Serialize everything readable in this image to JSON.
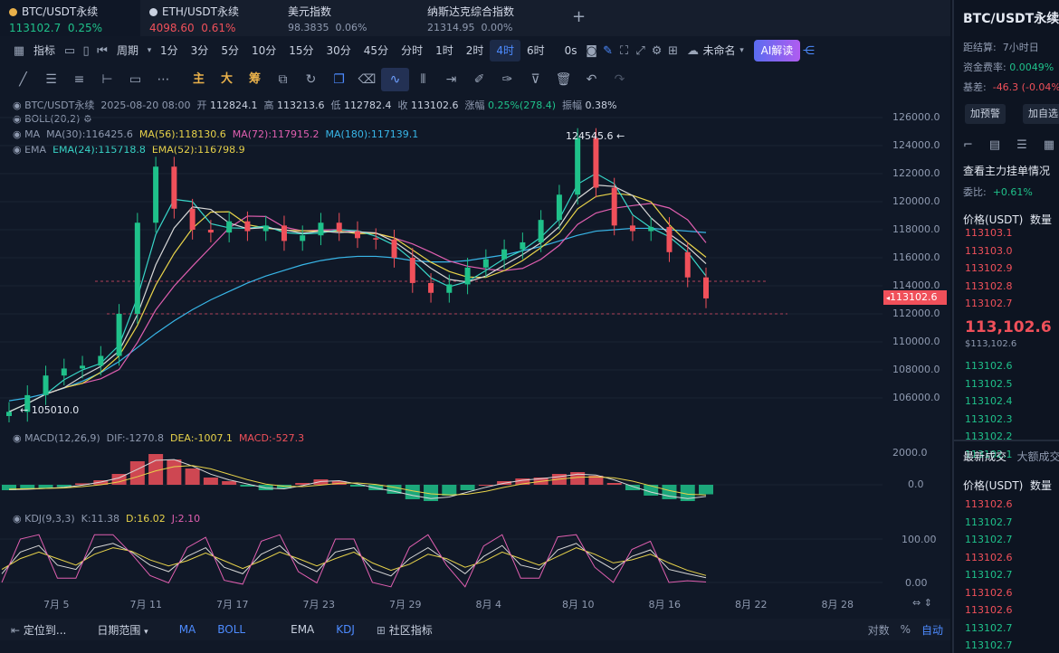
{
  "tabs": [
    {
      "name": "BTC/USDT永续",
      "price": "113102.7",
      "change": "0.25%",
      "dot_color": "#e8b04a",
      "price_color": "#1fc18a"
    },
    {
      "name": "ETH/USDT永续",
      "price": "4098.60",
      "change": "0.61%",
      "dot_color": "#c9d1e0",
      "price_color": "#f0505a"
    },
    {
      "name": "美元指数",
      "price": "98.3835",
      "change": "0.06%",
      "dot_color": "",
      "price_color": "#8f9ab0"
    },
    {
      "name": "纳斯达克综合指数",
      "price": "21314.95",
      "change": "0.00%",
      "dot_color": "",
      "price_color": "#8f9ab0"
    }
  ],
  "tab_add": "+",
  "toolbar": {
    "indicator_label": "指标",
    "period_label": "周期",
    "periods": [
      "1分",
      "3分",
      "5分",
      "10分",
      "15分",
      "30分",
      "45分",
      "分时",
      "1时",
      "2时",
      "4时",
      "6时"
    ],
    "active_period": "4时",
    "zero_s": "0s",
    "layout_name": "未命名",
    "ai_label": "AI解读"
  },
  "drawing_tools": [
    "主",
    "大",
    "筹"
  ],
  "chart_info": {
    "symbol": "BTC/USDT永续",
    "datetime": "2025-08-20 08:00",
    "open_label": "开",
    "open": "112824.1",
    "high_label": "高",
    "high": "113213.6",
    "low_label": "低",
    "low": "112782.4",
    "close_label": "收",
    "close": "113102.6",
    "change_label": "涨幅",
    "change": "0.25%(278.4)",
    "amp_label": "振幅",
    "amp": "0.38%",
    "boll": "BOLL(20,2)",
    "ma_label": "MA",
    "ma30": "MA(30):116425.6",
    "ma56": "MA(56):118130.6",
    "ma72": "MA(72):117915.2",
    "ma180": "MA(180):117139.1",
    "ema_label": "EMA",
    "ema24": "EMA(24):115718.8",
    "ema52": "EMA(52):116798.9",
    "macd": "MACD(12,26,9)",
    "dif": "DIF:-1270.8",
    "dea": "DEA:-1007.1",
    "macdv": "MACD:-527.3",
    "kdj": "KDJ(9,3,3)",
    "k": "K:11.38",
    "d": "D:16.02",
    "j": "J:2.10"
  },
  "chart_data": {
    "type": "line",
    "title": "",
    "price_axis": {
      "ticks": [
        "126000.0",
        "124000.0",
        "122000.0",
        "120000.0",
        "118000.0",
        "116000.0",
        "114000.0",
        "112000.0",
        "110000.0",
        "108000.0",
        "106000.0"
      ],
      "range": [
        104000,
        127000
      ]
    },
    "x_ticks": [
      "7月 5",
      "7月 11",
      "7月 17",
      "7月 23",
      "7月 29",
      "8月 4",
      "8月 10",
      "8月 16",
      "8月 22",
      "8月 28"
    ],
    "price_close": [
      105010,
      106200,
      107600,
      108100,
      108300,
      109000,
      112000,
      118500,
      122500,
      119500,
      118000,
      117800,
      118600,
      117900,
      118300,
      117200,
      117600,
      118500,
      117900,
      117400,
      117300,
      116000,
      114200,
      113500,
      114100,
      115300,
      115900,
      116600,
      117100,
      118700,
      120500,
      124545,
      121000,
      118300,
      117900,
      118200,
      116400,
      114600,
      113102
    ],
    "ma_slow": [
      105800,
      106000,
      106300,
      106700,
      107200,
      107800,
      108600,
      109600,
      110600,
      111500,
      112300,
      113000,
      113600,
      114200,
      114700,
      115100,
      115500,
      115800,
      116000,
      116100,
      116100,
      116000,
      115800,
      115700,
      115700,
      115800,
      116000,
      116200,
      116500,
      116800,
      117200,
      117600,
      117900,
      118000,
      118100,
      118100,
      118000,
      117900,
      117800
    ],
    "high_marker": "124545.6",
    "low_marker": "105010.0",
    "current_price": "113102.6",
    "macd_axis": [
      "2000.0",
      "0.0"
    ],
    "macd_hist": [
      -300,
      -250,
      -200,
      -120,
      80,
      250,
      600,
      1300,
      1700,
      1400,
      900,
      400,
      200,
      -100,
      -300,
      -200,
      100,
      300,
      200,
      -100,
      -300,
      -500,
      -800,
      -900,
      -600,
      -300,
      0,
      200,
      350,
      400,
      600,
      700,
      500,
      100,
      -300,
      -600,
      -800,
      -900,
      -527
    ],
    "kdj_axis": [
      "100.00",
      "0.00"
    ],
    "kdj_k": [
      20,
      70,
      85,
      40,
      30,
      80,
      90,
      70,
      40,
      25,
      60,
      80,
      35,
      20,
      65,
      85,
      45,
      25,
      70,
      80,
      30,
      15,
      55,
      80,
      50,
      20,
      60,
      85,
      40,
      30,
      75,
      90,
      55,
      30,
      60,
      75,
      30,
      20,
      11
    ],
    "kdj_d": [
      30,
      55,
      70,
      55,
      40,
      65,
      80,
      72,
      52,
      38,
      50,
      68,
      50,
      32,
      50,
      70,
      55,
      38,
      55,
      70,
      45,
      28,
      42,
      65,
      55,
      35,
      48,
      70,
      55,
      40,
      60,
      80,
      65,
      45,
      52,
      65,
      45,
      28,
      16
    ]
  },
  "bottom_bar": {
    "locate": "定位到...",
    "range": "日期范围",
    "ind": [
      "MA",
      "BOLL",
      "EMA",
      "KDJ"
    ],
    "community": "社区指标",
    "log": "对数",
    "pct": "%",
    "auto": "自动"
  },
  "right_panel": {
    "title": "BTC/USDT永续",
    "settle_label": "距结算:",
    "settle": "7小时日",
    "fund_label": "资金费率:",
    "fund": "0.0049%",
    "basis_label": "基差:",
    "basis": "-46.3 (-0.04%)",
    "btn_alert": "加预警",
    "btn_watch": "加自选",
    "depth_title": "查看主力挂单情况",
    "ratio_label": "委比:",
    "ratio": "+0.61%",
    "col_price": "价格(USDT)",
    "col_qty": "数量",
    "asks": [
      "113103.1",
      "113103.0",
      "113102.9",
      "113102.8",
      "113102.7"
    ],
    "mid_price": "113,102.6",
    "mid_sub": "$113,102.6",
    "bids": [
      "113102.6",
      "113102.5",
      "113102.4",
      "113102.3",
      "113102.2",
      "113102.1"
    ],
    "trades_tab": "最新成交",
    "trades_tab2": "大额成交",
    "trades": [
      "113102.6",
      "113102.7",
      "113102.7",
      "113102.6",
      "113102.7",
      "113102.6",
      "113102.6",
      "113102.7",
      "113102.7",
      "113102.7"
    ],
    "trade_colors": [
      "#f0505a",
      "#1fc18a",
      "#1fc18a",
      "#f0505a",
      "#1fc18a",
      "#f0505a",
      "#f0505a",
      "#1fc18a",
      "#1fc18a",
      "#1fc18a"
    ]
  },
  "colors": {
    "up": "#1fc18a",
    "down": "#f0505a",
    "accent": "#4d8bff",
    "ma_yellow": "#e8d34a",
    "ma_pink": "#e05fb0",
    "ma_blue": "#38b6e8"
  }
}
